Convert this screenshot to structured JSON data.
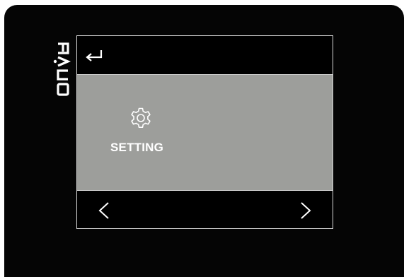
{
  "brand": {
    "logo_text": "EVCO"
  },
  "header": {
    "back_icon": "return-arrow-icon"
  },
  "menu": {
    "items": [
      {
        "icon": "gear-icon",
        "label": "SETTING"
      }
    ]
  },
  "footer": {
    "prev_icon": "chevron-left-icon",
    "next_icon": "chevron-right-icon"
  },
  "colors": {
    "bezel": "#050505",
    "screen_background": "#000000",
    "content_background": "#9d9e9b",
    "border": "#d8d8d8",
    "text": "#ffffff"
  }
}
